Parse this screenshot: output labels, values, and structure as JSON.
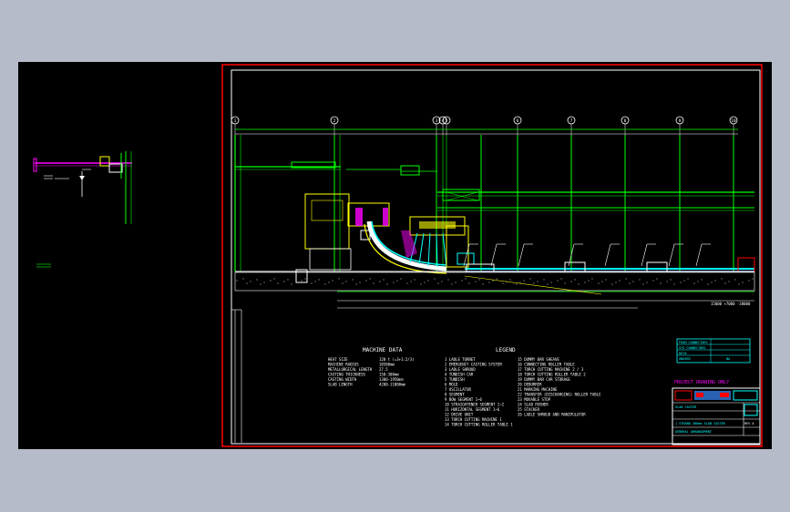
{
  "colors": {
    "background": "#b5bbc8",
    "viewport": "#000000",
    "green": "#00ff00",
    "yellow": "#ffff00",
    "magenta": "#ff00ff",
    "cyan": "#00ffff",
    "white": "#ffffff",
    "red": "#ff0000",
    "blue": "#3c8cff",
    "gray": "#808080"
  },
  "grid_bubbles": [
    "1",
    "2",
    "3",
    "4",
    "5",
    "6",
    "7",
    "8",
    "9",
    "10"
  ],
  "machine_data": {
    "title": "MACHINE DATA",
    "rows": [
      {
        "label": "HEAT SIZE",
        "value": "120 t (=3+1:2/3)"
      },
      {
        "label": "MACHINE RADIUS",
        "value": "10500mm"
      },
      {
        "label": "METALLURGICAL LENGTH",
        "value": "27.5"
      },
      {
        "label": "CASTING THICKNESS",
        "value": "150-300mm"
      },
      {
        "label": "CASTING WIDTH",
        "value": "1300-1950mm"
      },
      {
        "label": "SLAB LENGTH",
        "value": "4200-11000mm"
      }
    ]
  },
  "legend": {
    "title": "LEGEND",
    "col1": [
      "1  LADLE TURRET",
      "2  EMERGENCY CASTING SYSTEM",
      "3  LADLE SHROUD",
      "4  TUNDISH CAR",
      "5  TUNDISH",
      "6  MOLD",
      "7  OSCILLATOR",
      "8  SEGMENT",
      "9  BOW SEGMENT 1~6",
      "10 STRAIGHTENER SEGMENT 1~2",
      "11 HORIZONTAL SEGMENT 1~6",
      "12 DRIVE UNIT",
      "13 TORCH CUTTING MACHINE 1",
      "14 TORCH CUTTING ROLLER TABLE 1"
    ],
    "col2": [
      "15 DUMMY BAR SHEAVE",
      "16 CONNECTING ROLLER TABLE",
      "17 TORCH CUTTING MACHINE 2 / 3",
      "18 TORCH CUTTING ROLLER TABLE 2",
      "19 DUMMY BAR CAR STORAGE",
      "20 DEBURRER",
      "21 MARKING MACHINE",
      "22 TRANSFER (DISCHARGING) ROLLER TABLE",
      "23 MOVABLE STOP",
      "24 SLAB PUSHER",
      "25 STACKER",
      "26 LADLE SHROUD AND MANIPULATOR"
    ]
  },
  "title_block": {
    "note_lines": [
      "FRAM CONNECTORS",
      "SYS CONNECTORS",
      "DATA",
      "UNUSED"
    ],
    "note_scale": "NA",
    "red_caption": "PROJECT DRAWING ONLY",
    "rows": [
      "SLAB CASTER",
      "1 STRAND 300mm SLAB CASTER",
      "GENERAL ARRANGEMENT"
    ],
    "sheet": "REV A"
  },
  "dimensions": {
    "bottom_right": "15000 +7000 -38000"
  }
}
